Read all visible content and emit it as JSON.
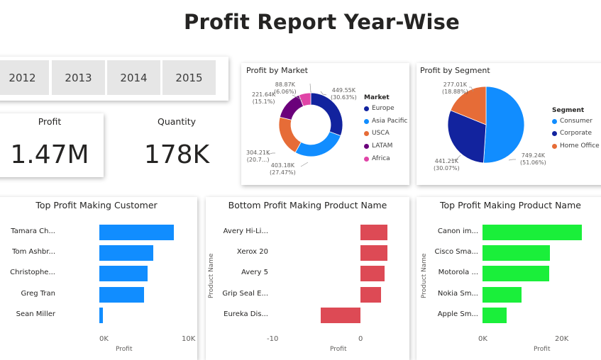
{
  "header": {
    "title": "Profit Report Year-Wise"
  },
  "slicer": {
    "years": [
      "2012",
      "2013",
      "2014",
      "2015"
    ]
  },
  "kpis": {
    "profit": {
      "label": "Profit",
      "value": "1.47M"
    },
    "quantity": {
      "label": "Quantity",
      "value": "178K"
    }
  },
  "market_chart": {
    "title": "Profit by Market",
    "legend_title": "Market",
    "slices": [
      {
        "name": "Europe",
        "color": "#12239e",
        "value": "449.55K",
        "pct": "(30.63%)"
      },
      {
        "name": "Asia Pacific",
        "color": "#118dff",
        "value": "403.18K",
        "pct": "(27.47%)"
      },
      {
        "name": "USCA",
        "color": "#e66c37",
        "value": "304.21K",
        "pct": "(20.7...)"
      },
      {
        "name": "LATAM",
        "color": "#6b007b",
        "value": "221.64K",
        "pct": "(15.1%)"
      },
      {
        "name": "Africa",
        "color": "#e044a7",
        "value": "88.87K",
        "pct": "(6.06%)"
      }
    ]
  },
  "segment_chart": {
    "title": "Profit by Segment",
    "legend_title": "Segment",
    "slices": [
      {
        "name": "Consumer",
        "color": "#118dff",
        "value": "749.24K",
        "pct": "(51.06%)"
      },
      {
        "name": "Corporate",
        "color": "#12239e",
        "value": "441.21K",
        "pct": "(30.07%)"
      },
      {
        "name": "Home Office",
        "color": "#e66c37",
        "value": "277.01K",
        "pct": "(18.88%)"
      }
    ]
  },
  "top_customer_chart": {
    "title": "Top Profit Making Customer",
    "xlabel": "Profit",
    "ticks": [
      "0K",
      "10K"
    ],
    "color": "#118dff",
    "categories": [
      "Tamara Ch...",
      "Tom Ashbr...",
      "Christophe...",
      "Greg Tran",
      "Sean Miller"
    ],
    "values": [
      8700,
      6300,
      5600,
      5200,
      400
    ]
  },
  "bottom_product_chart": {
    "title": "Bottom Profit Making Product Name",
    "xlabel": "Profit",
    "ylabel": "Product Name",
    "ticks": [
      "-10",
      "0"
    ],
    "color": "#dd4a55",
    "categories": [
      "Avery Hi-Li...",
      "Xerox 20",
      "Avery 5",
      "Grip Seal E...",
      "Eureka Dis..."
    ],
    "values": [
      3.2,
      3.2,
      2.8,
      2.4,
      -4.7
    ]
  },
  "top_product_chart": {
    "title": "Top Profit Making Product Name",
    "xlabel": "Profit",
    "ylabel": "Product Name",
    "ticks": [
      "0K",
      "20K"
    ],
    "color": "#1aef3a",
    "categories": [
      "Canon im...",
      "Cisco Sma...",
      "Motorola ...",
      "Nokia Sm...",
      "Apple Sm..."
    ],
    "values": [
      25200,
      17200,
      17000,
      9900,
      6100
    ]
  },
  "chart_data": [
    {
      "type": "pie",
      "title": "Profit by Market",
      "categories": [
        "Europe",
        "Asia Pacific",
        "USCA",
        "LATAM",
        "Africa"
      ],
      "values": [
        449550,
        403180,
        304210,
        221640,
        88870
      ]
    },
    {
      "type": "pie",
      "title": "Profit by Segment",
      "categories": [
        "Consumer",
        "Corporate",
        "Home Office"
      ],
      "values": [
        749240,
        441210,
        277010
      ]
    },
    {
      "type": "bar",
      "title": "Top Profit Making Customer",
      "categories": [
        "Tamara Ch...",
        "Tom Ashbr...",
        "Christophe...",
        "Greg Tran",
        "Sean Miller"
      ],
      "values": [
        8700,
        6300,
        5600,
        5200,
        400
      ],
      "xlabel": "Profit"
    },
    {
      "type": "bar",
      "title": "Bottom Profit Making Product Name",
      "categories": [
        "Avery Hi-Li...",
        "Xerox 20",
        "Avery 5",
        "Grip Seal E...",
        "Eureka Dis..."
      ],
      "values": [
        3.2,
        3.2,
        2.8,
        2.4,
        -4.7
      ],
      "xlabel": "Profit",
      "ylabel": "Product Name"
    },
    {
      "type": "bar",
      "title": "Top Profit Making Product Name",
      "categories": [
        "Canon im...",
        "Cisco Sma...",
        "Motorola ...",
        "Nokia Sm...",
        "Apple Sm..."
      ],
      "values": [
        25200,
        17200,
        17000,
        9900,
        6100
      ],
      "xlabel": "Profit",
      "ylabel": "Product Name"
    }
  ]
}
